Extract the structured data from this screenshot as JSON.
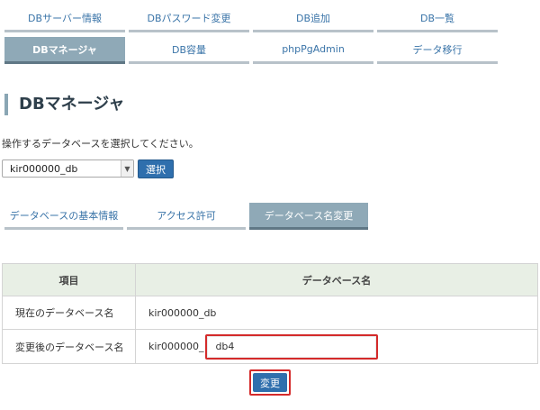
{
  "nav": {
    "row1": [
      {
        "label": "DBサーバー情報",
        "active": false
      },
      {
        "label": "DBパスワード変更",
        "active": false
      },
      {
        "label": "DB追加",
        "active": false
      },
      {
        "label": "DB一覧",
        "active": false
      }
    ],
    "row2": [
      {
        "label": "DBマネージャ",
        "active": true
      },
      {
        "label": "DB容量",
        "active": false
      },
      {
        "label": "phpPgAdmin",
        "active": false
      },
      {
        "label": "データ移行",
        "active": false
      }
    ]
  },
  "page": {
    "title": "DBマネージャ",
    "instruction": "操作するデータベースを選択してください。"
  },
  "db_select": {
    "value": "kir000000_db",
    "button_label": "選択"
  },
  "subtabs": [
    {
      "label": "データベースの基本情報",
      "active": false
    },
    {
      "label": "アクセス許可",
      "active": false
    },
    {
      "label": "データベース名変更",
      "active": true
    }
  ],
  "table": {
    "headers": [
      "項目",
      "データベース名"
    ],
    "rows": [
      {
        "label": "現在のデータベース名",
        "value": "kir000000_db"
      },
      {
        "label": "変更後のデータベース名",
        "prefix": "kir000000_",
        "input_value": "db4"
      }
    ]
  },
  "actions": {
    "change_label": "変更"
  },
  "colors": {
    "link": "#3a74a8",
    "active_tab": "#8fa9b7",
    "primary_button": "#2f6fad",
    "table_header_bg": "#e8efe5",
    "highlight": "#d42a2a"
  }
}
